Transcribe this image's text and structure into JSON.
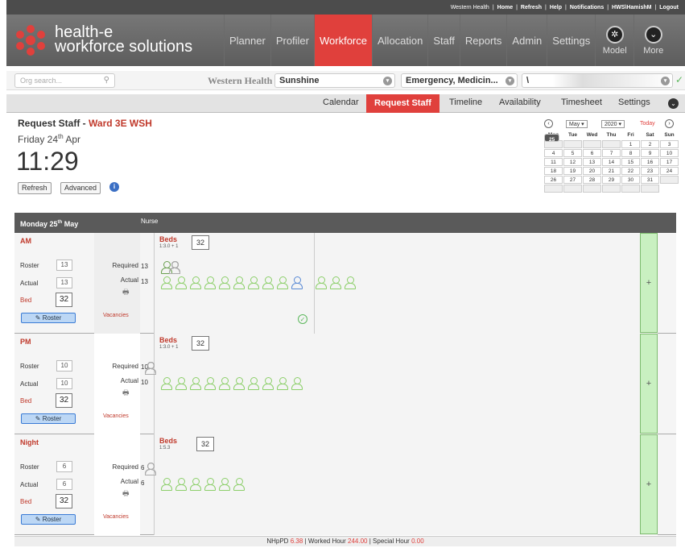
{
  "topbar": {
    "org": "Western Health",
    "links": [
      "Home",
      "Refresh",
      "Help",
      "Notifications",
      "HWS\\HamishM",
      "Logout"
    ]
  },
  "brand": {
    "line1": "health-e",
    "line2": "workforce solutions"
  },
  "nav": {
    "items": [
      "Planner",
      "Profiler",
      "Workforce",
      "Allocation",
      "Staff",
      "Reports",
      "Admin",
      "Settings"
    ],
    "active": "Workforce",
    "model": "Model",
    "more": "More"
  },
  "filters": {
    "org_search_placeholder": "Org search...",
    "org_name": "Western Health",
    "site": "Sunshine",
    "unit": "Emergency, Medicin...",
    "ward": "\\"
  },
  "subtabs": {
    "items": [
      "Calendar",
      "Request Staff",
      "Timeline",
      "Availability",
      "Timesheet",
      "Settings"
    ],
    "active": "Request Staff"
  },
  "page": {
    "title": "Request Staff",
    "ward": "Ward 3E WSH",
    "date_day": "Friday 24",
    "date_sup": "th",
    "date_month": "Apr",
    "time": "11:29",
    "refresh": "Refresh",
    "advanced": "Advanced"
  },
  "calendar": {
    "month": "May",
    "year": "2020",
    "today": "Today",
    "weekdays": [
      "Mon",
      "Tue",
      "Wed",
      "Thu",
      "Fri",
      "Sat",
      "Sun"
    ],
    "days": [
      "",
      "",
      "",
      "",
      "1",
      "2",
      "3",
      "4",
      "5",
      "6",
      "7",
      "8",
      "9",
      "10",
      "11",
      "12",
      "13",
      "14",
      "15",
      "16",
      "17",
      "18",
      "19",
      "20",
      "21",
      "22",
      "23",
      "24",
      "25",
      "26",
      "27",
      "28",
      "29",
      "30",
      "31",
      "",
      "",
      "",
      "",
      "",
      "",
      ""
    ],
    "selected": "25"
  },
  "grid": {
    "day": "Monday 25",
    "day_sup": "th",
    "day_month": "May",
    "nurse_label": "Nurse",
    "shifts": [
      {
        "name": "AM",
        "roster": "13",
        "actual": "13",
        "bed": "32",
        "required": "13",
        "actual_count": "13",
        "beds_ratio": "1:3.0 + 1",
        "beds_val": "32"
      },
      {
        "name": "PM",
        "roster": "10",
        "actual": "10",
        "bed": "32",
        "required": "10",
        "actual_count": "10",
        "beds_ratio": "1:3.0 + 1",
        "beds_val": "32"
      },
      {
        "name": "Night",
        "roster": "6",
        "actual": "6",
        "bed": "32",
        "required": "6",
        "actual_count": "6",
        "beds_ratio": "1:5.3",
        "beds_val": "32"
      }
    ],
    "labels": {
      "roster": "Roster",
      "actual": "Actual",
      "bed": "Bed",
      "required": "Required",
      "actual_r": "Actual",
      "vacancies": "Vacancies",
      "roster_btn": "Roster",
      "beds": "Beds",
      "plus": "+"
    }
  },
  "footer": {
    "nhppd_label": "NHpPD",
    "nhppd": "6.38",
    "worked_label": "Worked Hour",
    "worked": "244.00",
    "special_label": "Special Hour",
    "special": "0.00"
  },
  "colors": {
    "accent": "#e0403c",
    "header": "#666666",
    "green": "#8ccf6a",
    "blue": "#5a8ad5"
  }
}
